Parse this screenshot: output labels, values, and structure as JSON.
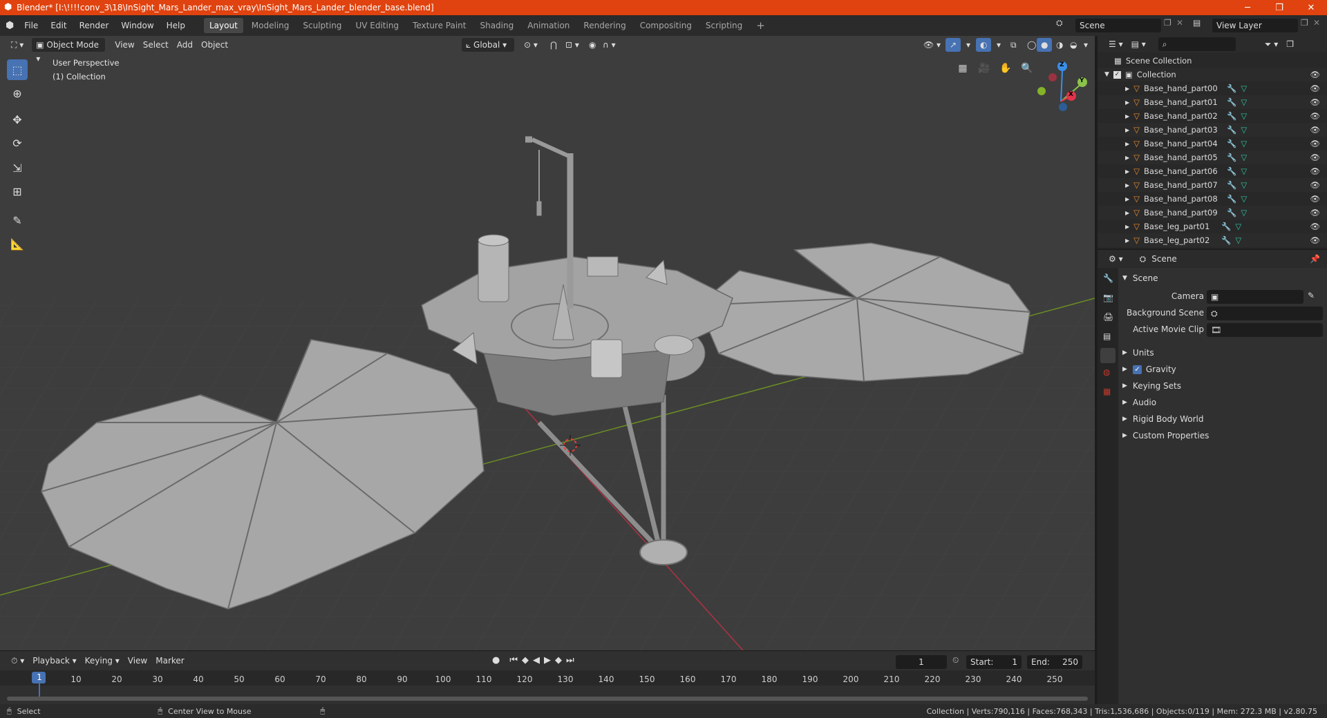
{
  "window": {
    "title": "Blender* [I:\\!!!!conv_3\\18\\InSight_Mars_Lander_max_vray\\InSight_Mars_Lander_blender_base.blend]",
    "minimize": "─",
    "maximize": "❐",
    "close": "✕"
  },
  "menu": [
    "File",
    "Edit",
    "Render",
    "Window",
    "Help"
  ],
  "workspaces": [
    "Layout",
    "Modeling",
    "Sculpting",
    "UV Editing",
    "Texture Paint",
    "Shading",
    "Animation",
    "Rendering",
    "Compositing",
    "Scripting"
  ],
  "workspace_add": "+",
  "scene_field": "Scene",
  "view_layer_field": "View Layer",
  "viewport_header": {
    "mode": "Object Mode",
    "menus": [
      "View",
      "Select",
      "Add",
      "Object"
    ],
    "orientation": "Global"
  },
  "viewport_overlay": {
    "line1": "User Perspective",
    "line2": "(1) Collection"
  },
  "gizmo": {
    "z": "Z",
    "y": "Y",
    "x": "X"
  },
  "outliner": {
    "root": "Scene Collection",
    "collection": "Collection",
    "items": [
      "Base_hand_part00",
      "Base_hand_part01",
      "Base_hand_part02",
      "Base_hand_part03",
      "Base_hand_part04",
      "Base_hand_part05",
      "Base_hand_part06",
      "Base_hand_part07",
      "Base_hand_part08",
      "Base_hand_part09",
      "Base_leg_part01",
      "Base_leg_part02"
    ]
  },
  "properties": {
    "header": "Scene",
    "panel_title": "Scene",
    "camera_label": "Camera",
    "background_scene_label": "Background Scene",
    "active_movie_clip_label": "Active Movie Clip",
    "sections": [
      "Units",
      "Gravity",
      "Keying Sets",
      "Audio",
      "Rigid Body World",
      "Custom Properties"
    ]
  },
  "timeline": {
    "menus": [
      "Playback",
      "Keying",
      "View",
      "Marker"
    ],
    "current_frame": "1",
    "start_label": "Start:",
    "start": "1",
    "end_label": "End:",
    "end": "250",
    "ruler": [
      "1",
      "10",
      "20",
      "30",
      "40",
      "50",
      "60",
      "70",
      "80",
      "90",
      "100",
      "110",
      "120",
      "130",
      "140",
      "150",
      "160",
      "170",
      "180",
      "190",
      "200",
      "210",
      "220",
      "230",
      "240",
      "250"
    ]
  },
  "status": {
    "left1": "Select",
    "left2": "Center View to Mouse",
    "right": "Collection | Verts:790,116 | Faces:768,343 | Tris:1,536,686 | Objects:0/119 | Mem: 272.3 MB | v2.80.75"
  },
  "colors": {
    "title_bar": "#e0430f",
    "accent": "#4772b3",
    "x_axis": "#e2334b",
    "y_axis": "#8bc34a",
    "z_axis": "#3b8ee8",
    "mesh_icon": "#e88c2f"
  }
}
